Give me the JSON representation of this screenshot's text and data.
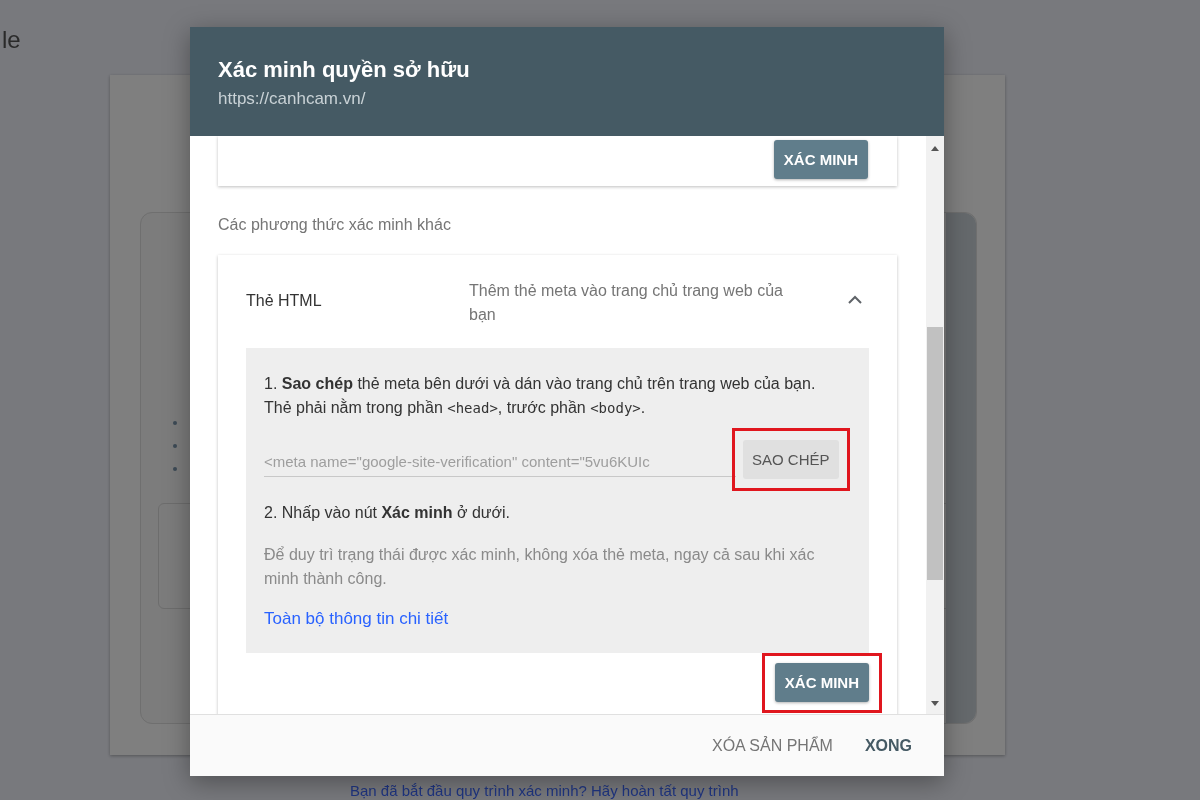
{
  "background_page": {
    "title_fragment": "le",
    "link": "Bạn đã bắt đầu quy trình xác minh? Hãy hoàn tất quy trình"
  },
  "dialog": {
    "title": "Xác minh quyền sở hữu",
    "url": "https://canhcam.vn/"
  },
  "top_method": {
    "button": "XÁC MINH"
  },
  "section_label": "Các phương thức xác minh khác",
  "method": {
    "name": "Thẻ HTML",
    "description": "Thêm thẻ meta vào trang chủ trang web của bạn",
    "expanded": true,
    "step1": [
      {
        "kind": "text",
        "text": "1. **Sao chép** thẻ meta bên dưới và dán vào trang chủ trên trang web của bạn. Thẻ phải nằm trong phần "
      },
      {
        "kind": "code",
        "text": "<head>"
      },
      {
        "kind": "text",
        "text": ", trước phần "
      },
      {
        "kind": "code",
        "text": "<body>"
      },
      {
        "kind": "text",
        "text": "."
      }
    ],
    "meta_value": "<meta name=\"google-site-verification\" content=\"5vu6KUIc",
    "copy_button": {
      "label": "SAO CHÉP",
      "highlighted": true
    },
    "step2": "2. Nhấp vào nút **Xác minh** ở dưới.",
    "note": "Để duy trì trạng thái được xác minh, không xóa thẻ meta, ngay cả sau khi xác minh thành công.",
    "details_link": "Toàn bộ thông tin chi tiết",
    "verify_button": {
      "label": "XÁC MINH",
      "highlighted": true
    }
  },
  "footer_buttons": [
    {
      "label": "XÓA SẢN PHẨM",
      "kind": "secondary"
    },
    {
      "label": "XONG",
      "kind": "primary"
    }
  ]
}
